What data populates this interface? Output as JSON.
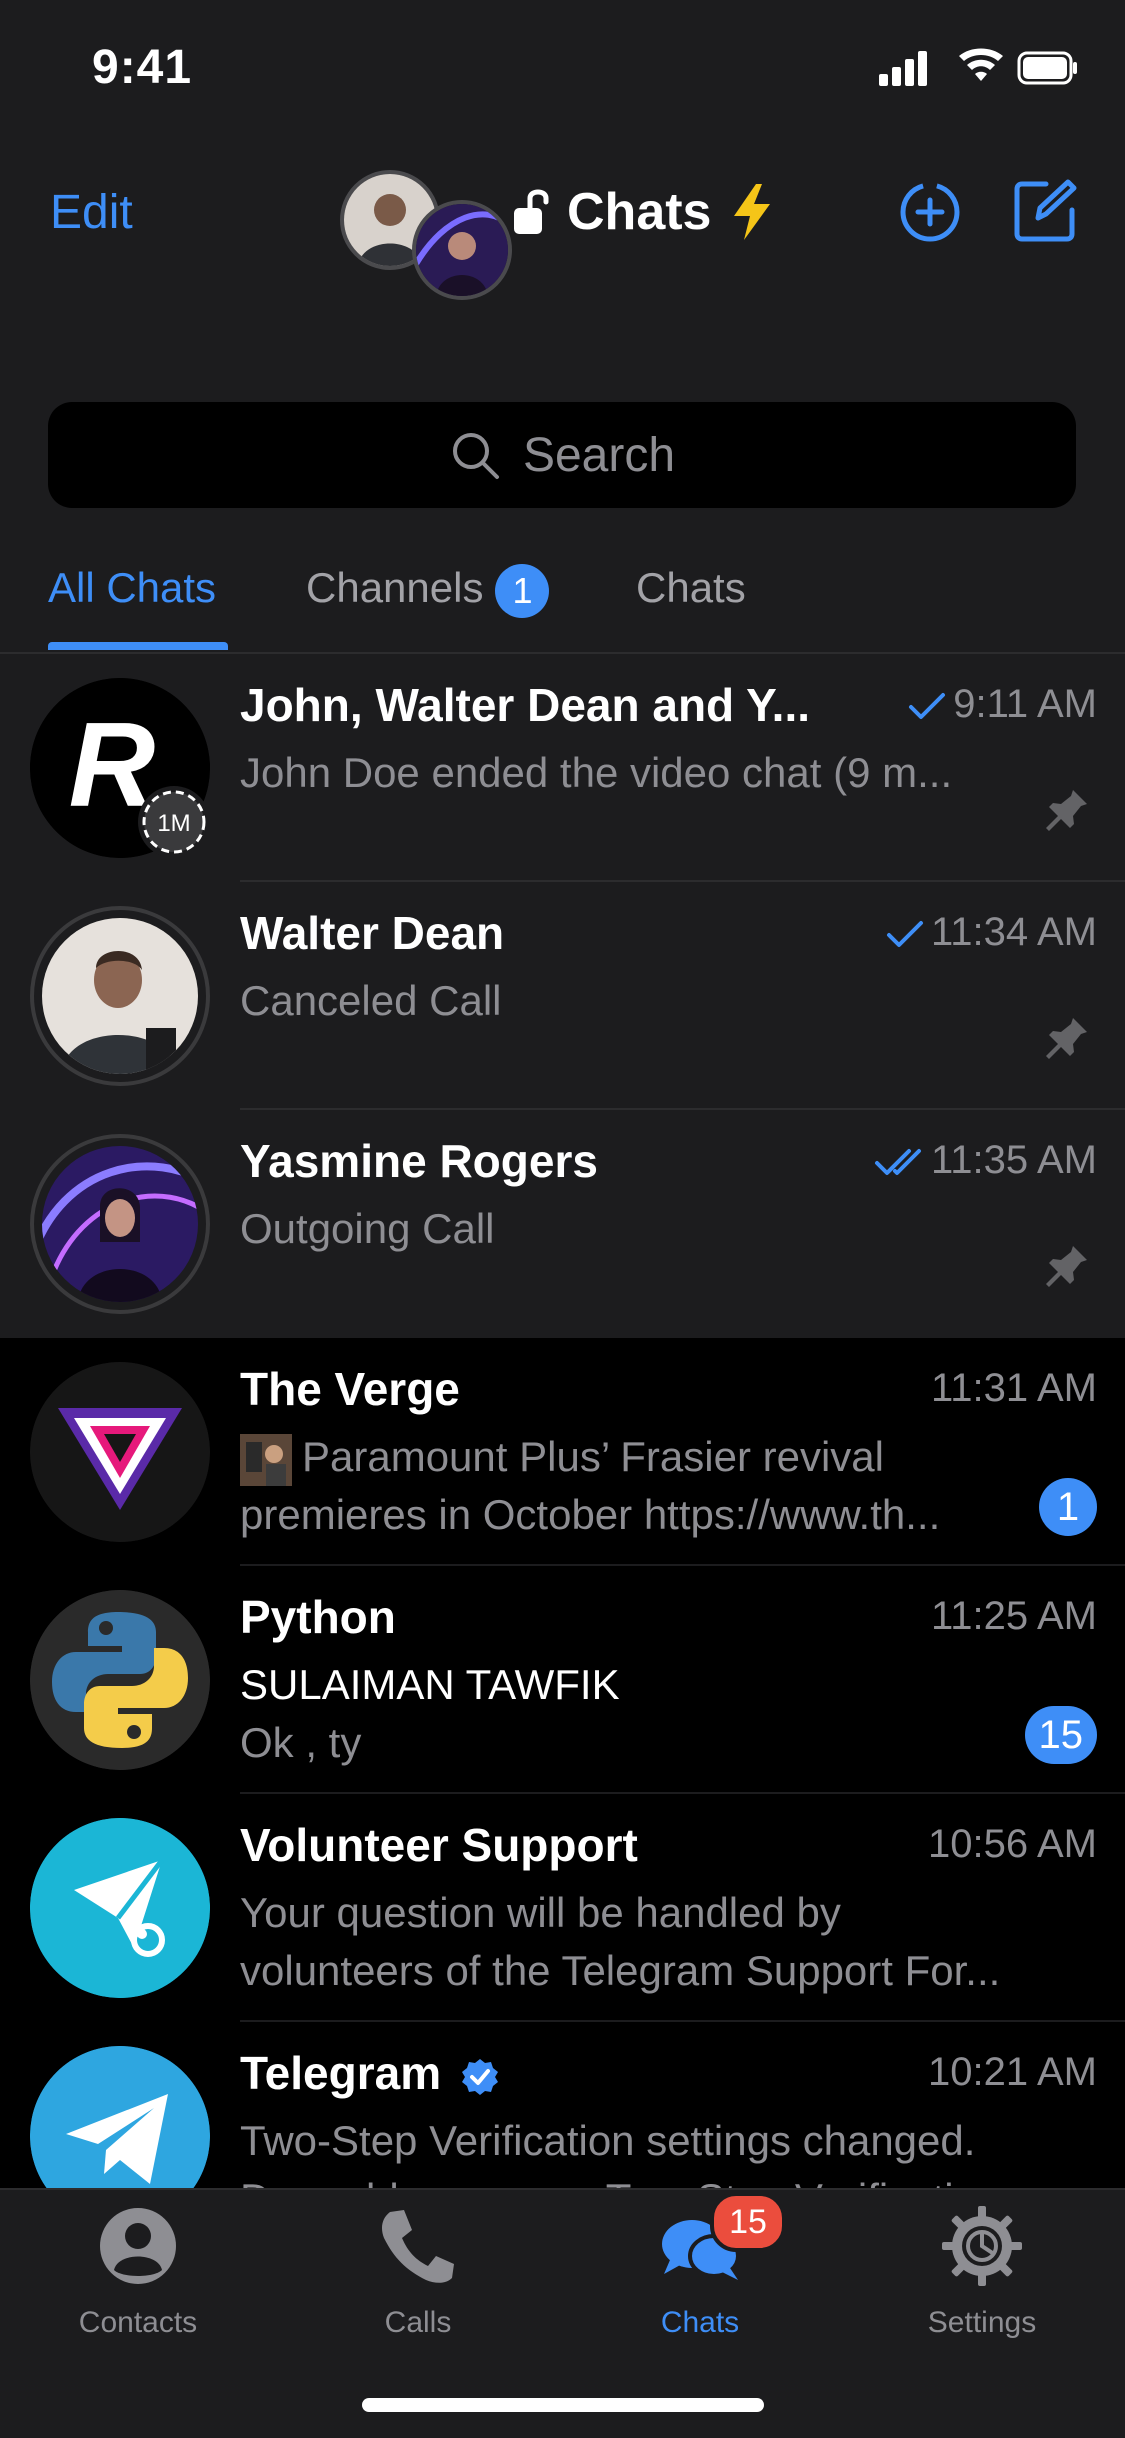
{
  "status_bar": {
    "time": "9:41"
  },
  "header": {
    "edit_label": "Edit",
    "title": "Chats"
  },
  "search": {
    "placeholder": "Search"
  },
  "tabs": [
    {
      "label": "All Chats",
      "active": true
    },
    {
      "label": "Channels",
      "badge": "1"
    },
    {
      "label": "Chats"
    }
  ],
  "chats": [
    {
      "name": "John, Walter Dean and Y...",
      "time": "9:11 AM",
      "status": "sent",
      "message": "John Doe ended the video chat (9 m...",
      "pinned": true,
      "avatar_label": "R",
      "avatar_sub": "1M"
    },
    {
      "name": "Walter Dean",
      "time": "11:34 AM",
      "status": "sent",
      "message": "Canceled Call",
      "pinned": true
    },
    {
      "name": "Yasmine Rogers",
      "time": "11:35 AM",
      "status": "read",
      "message": "Outgoing Call",
      "pinned": true
    },
    {
      "name": "The Verge",
      "time": "11:31 AM",
      "message_line1": "Paramount Plus’ Frasier revival",
      "message_line2": "premieres in October https://www.th...",
      "badge": "1"
    },
    {
      "name": "Python",
      "time": "11:25 AM",
      "sender": "SULAIMAN TAWFIK",
      "message": "Ok , ty",
      "badge": "15"
    },
    {
      "name": "Volunteer Support",
      "time": "10:56 AM",
      "message_line1": "Your question will be handled by",
      "message_line2": "volunteers of the Telegram Support For..."
    },
    {
      "name": "Telegram",
      "time": "10:21 AM",
      "verified": true,
      "message_line1": "Two-Step Verification settings changed.",
      "message_line2": "Dear old user, your Two-Step Verificatio"
    }
  ],
  "tabbar": [
    {
      "label": "Contacts",
      "icon": "person-icon"
    },
    {
      "label": "Calls",
      "icon": "phone-icon"
    },
    {
      "label": "Chats",
      "icon": "chat-bubbles-icon",
      "badge": "15",
      "active": true
    },
    {
      "label": "Settings",
      "icon": "gear-icon"
    }
  ],
  "colors": {
    "accent": "#3e8ef7",
    "background": "#000000",
    "header_bg": "#1c1c1e",
    "badge_red": "#eb4d3d"
  }
}
